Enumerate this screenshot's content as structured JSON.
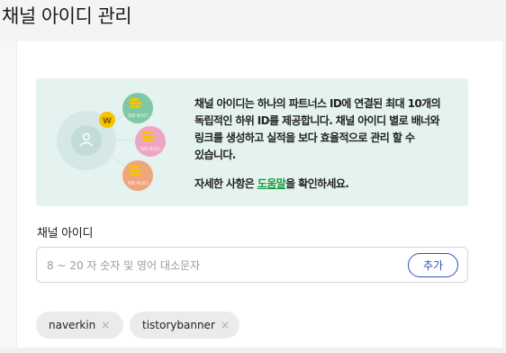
{
  "page": {
    "title": "채널 아이디 관리"
  },
  "info": {
    "line1": "채널 아이디는 하나의 파트너스 ID에 연결된 최대 10개의",
    "line2": "독립적인 하위 ID를 제공합니다. 채널 아이디 별로 배너와",
    "line3": "링크를 생성하고 실적을 보다 효율적으로 관리 할 수",
    "line4": "있습니다.",
    "help_prefix": "자세한 사항은 ",
    "help_link": "도움말",
    "help_suffix": "을 확인하세요.",
    "illustration": {
      "coin_label": "W",
      "card_label": "자회 아이디"
    }
  },
  "form": {
    "label": "채널 아이디",
    "placeholder": "8 ~ 20 자 숫자 및 영어 대소문자",
    "value": "",
    "add_button": "추가"
  },
  "tags": [
    {
      "label": "naverkin",
      "remove": "×"
    },
    {
      "label": "tistorybanner",
      "remove": "×"
    }
  ],
  "colors": {
    "info_bg": "#e4f2f0",
    "accent_blue": "#2b52b8",
    "link_green": "#1a9a3c",
    "tag_bg": "#ebebeb",
    "bubble_green": "#7ec9a4",
    "bubble_pink": "#eea6c1",
    "bubble_orange": "#f0a67d",
    "coin_yellow": "#f5c400"
  },
  "icons": {
    "user": "user-icon",
    "coin": "coin-icon",
    "remove": "close-icon"
  }
}
